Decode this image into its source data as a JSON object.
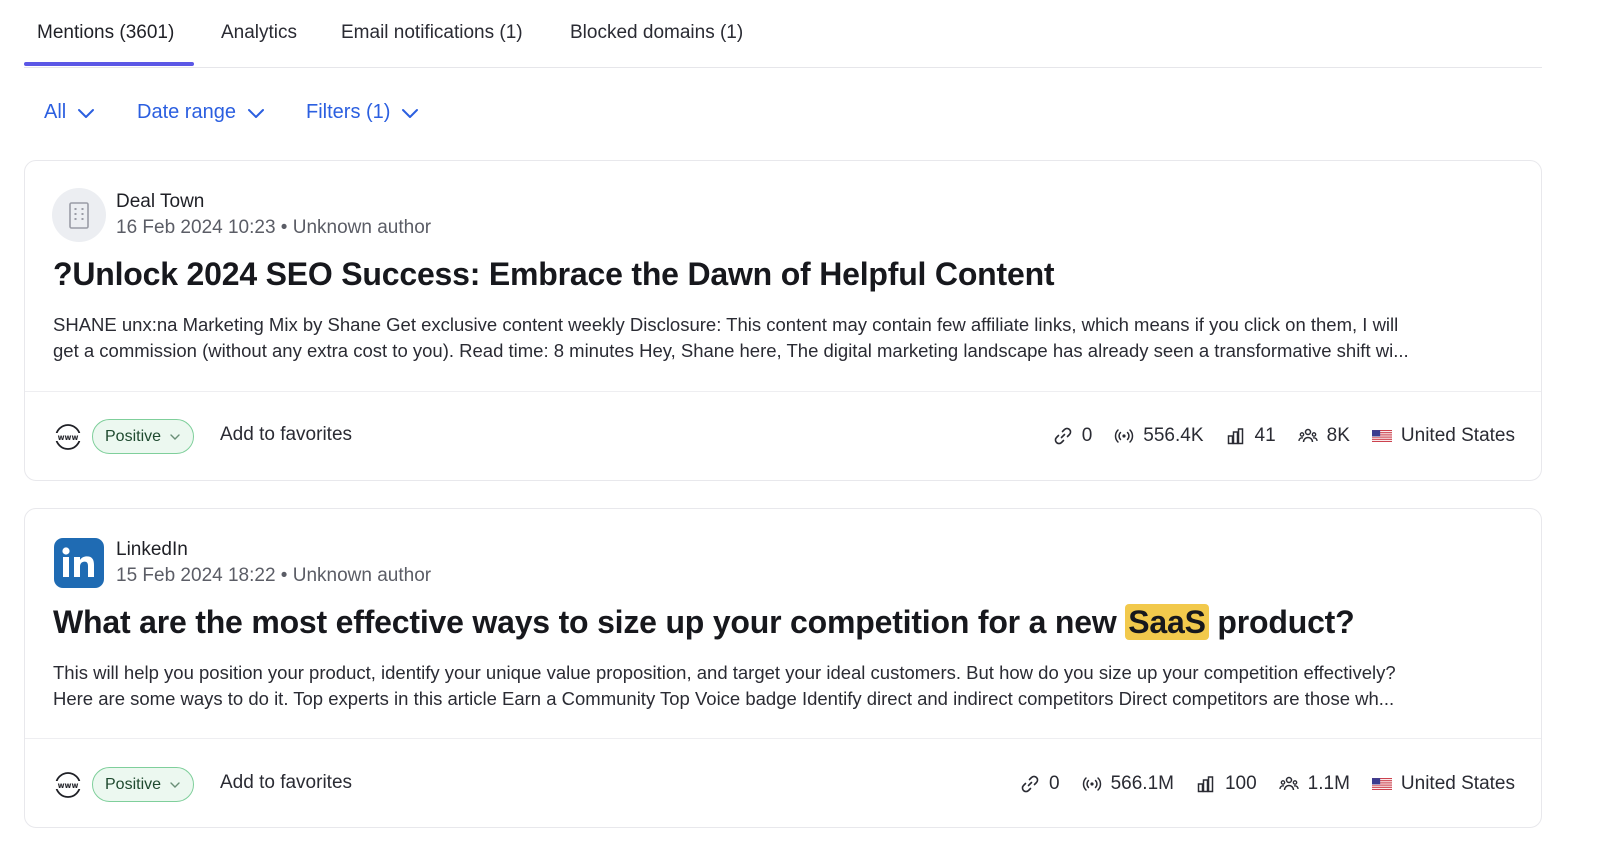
{
  "tabs": [
    {
      "label": "Mentions (3601)",
      "active": true
    },
    {
      "label": "Analytics",
      "active": false
    },
    {
      "label": "Email notifications (1)",
      "active": false
    },
    {
      "label": "Blocked domains (1)",
      "active": false
    }
  ],
  "filters": {
    "all_label": "All",
    "date_label": "Date range",
    "filters_label": "Filters (1)"
  },
  "colors": {
    "accent": "#5b57e6",
    "link": "#2b5fe0",
    "positive_bg": "#ecf8f0",
    "positive_border": "#7fcf9b",
    "highlight": "#f2c94c",
    "linkedin": "#1f6bb3"
  },
  "mentions": [
    {
      "source": "Deal Town",
      "source_icon": "building-icon",
      "meta": "16 Feb 2024 10:23 • Unknown author",
      "title": "?Unlock 2024 SEO Success: Embrace the Dawn of Helpful Content",
      "excerpt_line1": "SHANE unx:na Marketing Mix by Shane Get exclusive content weekly Disclosure: This content may contain few affiliate links, which means if you click on them, I will",
      "excerpt_line2": "get a commission (without any extra cost to you). Read time: 8 minutes Hey, Shane here, The digital marketing landscape has already seen a transformative shift wi...",
      "sentiment": "Positive",
      "favorite_label": "Add to favorites",
      "links": "0",
      "reach": "556.4K",
      "influence": "41",
      "followers": "8K",
      "country": "United States"
    },
    {
      "source": "LinkedIn",
      "source_icon": "linkedin-icon",
      "meta": "15 Feb 2024 18:22 • Unknown author",
      "title_before": "What are the most effective ways to size up your competition for a new ",
      "title_highlight": "SaaS",
      "title_after": " product?",
      "excerpt_line1": "This will help you position your product, identify your unique value proposition, and target your ideal customers. But how do you size up your competition effectively?",
      "excerpt_line2": "Here are some ways to do it. Top experts in this article Earn a Community Top Voice badge Identify direct and indirect competitors Direct competitors are those wh...",
      "sentiment": "Positive",
      "favorite_label": "Add to favorites",
      "links": "0",
      "reach": "566.1M",
      "influence": "100",
      "followers": "1.1M",
      "country": "United States"
    }
  ]
}
